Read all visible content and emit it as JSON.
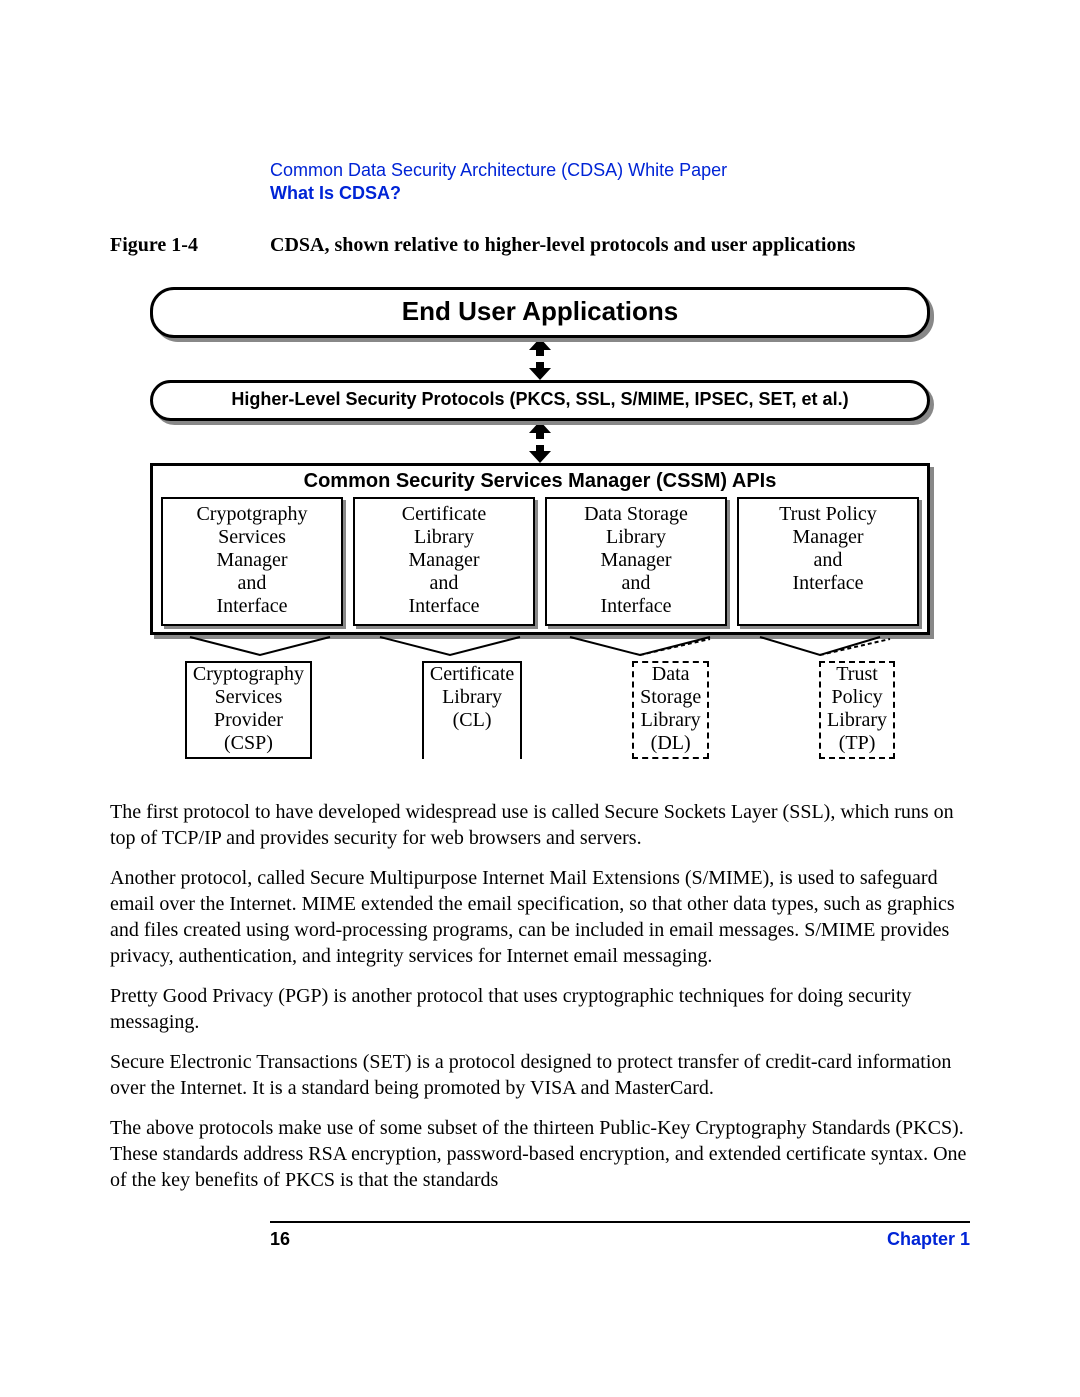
{
  "header": {
    "line1": "Common Data Security Architecture (CDSA) White Paper",
    "line2": "What Is CDSA?"
  },
  "figure": {
    "label": "Figure 1-4",
    "caption": "CDSA, shown relative to higher-level protocols and user applications"
  },
  "diagram": {
    "end_user": "End User Applications",
    "protocols": "Higher-Level Security Protocols (PKCS, SSL, S/MIME, IPSEC, SET, et al.)",
    "cssm_title": "Common Security Services Manager (CSSM) APIs",
    "managers": [
      "Crypotgraphy\nServices\nManager\nand\nInterface",
      "Certificate\nLibrary\nManager\nand\nInterface",
      "Data Storage\nLibrary\nManager\nand\nInterface",
      "Trust Policy\nManager\nand\nInterface"
    ],
    "plugins": [
      "Cryptography\nServices\nProvider\n(CSP)",
      "Certificate\nLibrary\n(CL)",
      "Data\nStorage\nLibrary\n(DL)",
      "Trust\nPolicy\nLibrary\n(TP)"
    ]
  },
  "paragraphs": [
    "The first protocol to have developed widespread use is called Secure Sockets Layer (SSL), which runs on top of TCP/IP and provides security for web browsers and servers.",
    "Another protocol, called Secure Multipurpose Internet Mail Extensions (S/MIME), is used to safeguard email over the Internet. MIME extended the email specification, so that other data types, such as graphics and files created using word-processing programs, can be included in email messages. S/MIME provides privacy, authentication, and integrity services for Internet email messaging.",
    "Pretty Good Privacy (PGP) is another protocol that uses cryptographic techniques for doing security messaging.",
    "Secure Electronic Transactions (SET) is a protocol designed to protect transfer of credit-card information over the Internet.  It is a standard being promoted by VISA and MasterCard.",
    "The above protocols make use of some subset of the thirteen Public-Key Cryptography Standards (PKCS). These standards address RSA encryption, password-based encryption, and extended certificate syntax. One of the key benefits of PKCS is that the standards"
  ],
  "footer": {
    "page": "16",
    "chapter": "Chapter 1"
  }
}
